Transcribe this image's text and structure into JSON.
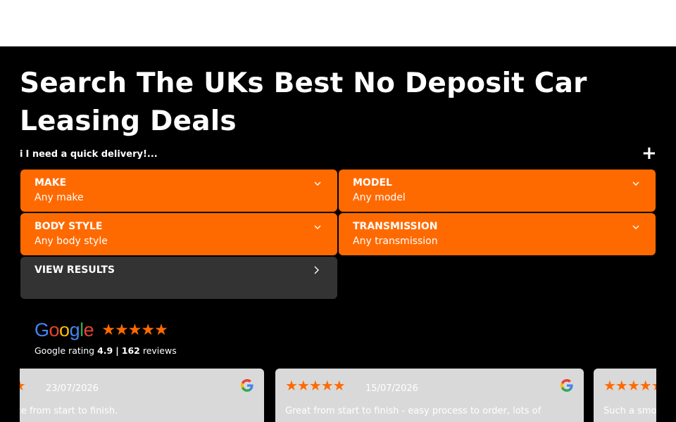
{
  "hero": {
    "title": "Search The UKs Best No Deposit Car Leasing Deals",
    "quick_delivery": "I need a quick delivery!...",
    "info_mark": "i",
    "plus": "+"
  },
  "search": {
    "make": {
      "label": "MAKE",
      "value": "Any make"
    },
    "model": {
      "label": "MODEL",
      "value": "Any model"
    },
    "body_style": {
      "label": "BODY STYLE",
      "value": "Any body style"
    },
    "transmission": {
      "label": "TRANSMISSION",
      "value": "Any transmission"
    },
    "view_results": "VIEW RESULTS"
  },
  "google": {
    "logo_letters": [
      "G",
      "o",
      "o",
      "g",
      "l",
      "e"
    ],
    "logo_colors": [
      "#4285F4",
      "#EA4335",
      "#FBBC05",
      "#4285F4",
      "#34A853",
      "#EA4335"
    ],
    "stars": "★★★★★",
    "rating_label": "Google rating",
    "rating_value": "4.9",
    "separator": "|",
    "review_count": "162",
    "reviews_label": "reviews"
  },
  "reviews": [
    {
      "stars": "★★★★★",
      "date": "23/07/2026",
      "text": "Great service from start to finish."
    },
    {
      "stars": "★★★★★",
      "date": "15/07/2026",
      "text": "Great from start to finish - easy process to order, lots of"
    },
    {
      "stars": "★★★★★",
      "date": "",
      "text": "Such a smooth"
    }
  ],
  "colors": {
    "accent": "#ff6a00",
    "dark_bg": "#000000",
    "button_dark": "#333333",
    "card_bg": "#d9d9d9"
  },
  "icons": {
    "chevron_down": "chevron-down-icon",
    "chevron_right": "chevron-right-icon",
    "google_g": "google-g-icon",
    "star": "star-icon"
  }
}
